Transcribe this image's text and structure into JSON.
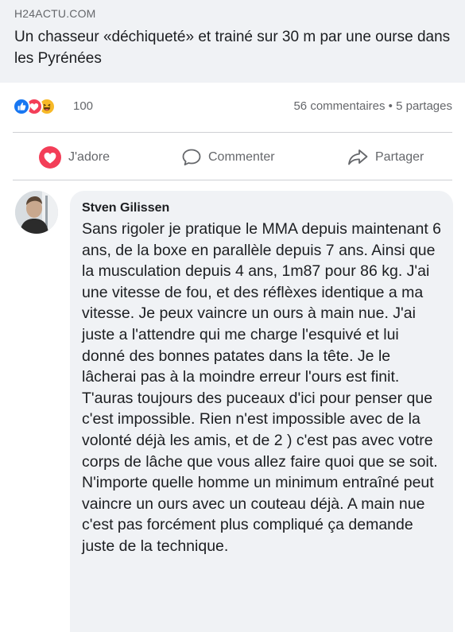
{
  "link_preview": {
    "domain": "H24ACTU.COM",
    "title": "Un chasseur «déchiqueté» et trainé sur 30 m par une ourse dans les Pyrénées"
  },
  "reactions": {
    "icons": [
      "like-icon",
      "love-icon",
      "haha-icon"
    ],
    "count": "100",
    "stats": "56 commentaires • 5 partages"
  },
  "actions": {
    "like_label": "J'adore",
    "comment_label": "Commenter",
    "share_label": "Partager"
  },
  "comment": {
    "author": "Stven Gilissen",
    "text": "Sans rigoler je pratique le MMA depuis maintenant 6 ans, de la boxe en parallèle depuis 7 ans. Ainsi que la musculation depuis 4 ans, 1m87 pour 86 kg. J'ai une vitesse de fou, et des réflèxes identique a ma vitesse. Je peux vaincre un ours à main nue. J'ai juste a l'attendre qui me charge l'esquivé et lui donné des bonnes patates dans la tête. Je le lâcherai pas à la moindre erreur l'ours est finit. T'auras toujours des puceaux d'ici pour penser que c'est impossible. Rien n'est impossible avec de la volonté déjà les amis, et de 2 ) c'est pas avec votre corps de lâche que vous allez faire quoi que se soit. N'importe quelle homme un minimum entraîné peut vaincre un ours avec un couteau déjà. A main nue c'est pas forcément plus compliqué ça demande juste de la technique."
  },
  "colors": {
    "like_blue": "#1877f2",
    "love_red": "#f33e58",
    "haha_yellow": "#f7b928",
    "text_secondary": "#65676b",
    "bubble_bg": "#f0f2f5"
  }
}
